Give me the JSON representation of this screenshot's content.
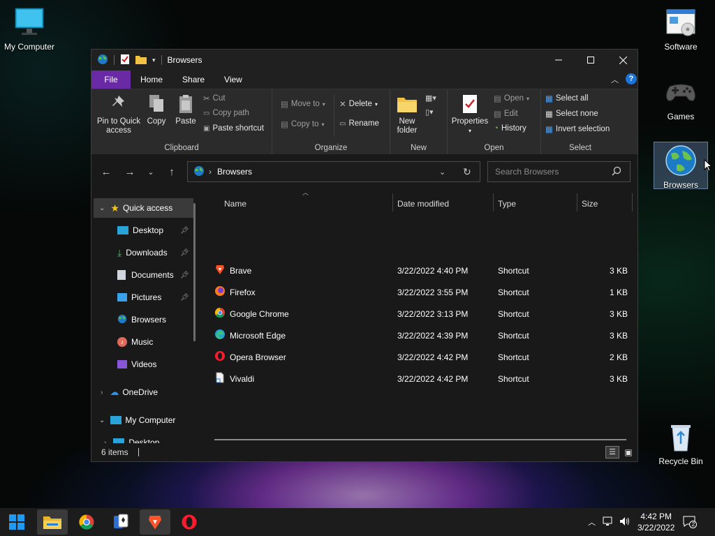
{
  "desktop": {
    "icons": [
      {
        "label": "My Computer"
      },
      {
        "label": "Software"
      },
      {
        "label": "Games"
      },
      {
        "label": "Browsers"
      },
      {
        "label": "Recycle Bin"
      }
    ]
  },
  "window": {
    "title": "Browsers",
    "tabs": [
      "File",
      "Home",
      "Share",
      "View"
    ],
    "ribbon": {
      "clipboard": {
        "group_label": "Clipboard",
        "pin_label": "Pin to Quick access",
        "copy_label": "Copy",
        "paste_label": "Paste",
        "cut_label": "Cut",
        "copy_path_label": "Copy path",
        "paste_shortcut_label": "Paste shortcut"
      },
      "organize": {
        "group_label": "Organize",
        "move_to_label": "Move to",
        "copy_to_label": "Copy to",
        "delete_label": "Delete",
        "rename_label": "Rename"
      },
      "new": {
        "group_label": "New",
        "new_folder_label": "New folder"
      },
      "open": {
        "group_label": "Open",
        "properties_label": "Properties",
        "open_label": "Open",
        "edit_label": "Edit",
        "history_label": "History"
      },
      "select": {
        "group_label": "Select",
        "select_all_label": "Select all",
        "select_none_label": "Select none",
        "invert_selection_label": "Invert selection"
      }
    },
    "address": {
      "path": "Browsers"
    },
    "search": {
      "placeholder": "Search Browsers"
    },
    "navigation": {
      "quick_access": "Quick access",
      "quick_items": [
        "Desktop",
        "Downloads",
        "Documents",
        "Pictures",
        "Browsers",
        "Music",
        "Videos"
      ],
      "onedrive": "OneDrive",
      "my_computer": "My Computer",
      "my_computer_items": [
        "Desktop"
      ]
    },
    "columns": {
      "name": "Name",
      "date": "Date modified",
      "type": "Type",
      "size": "Size"
    },
    "files": [
      {
        "name": "Brave",
        "date": "3/22/2022 4:40 PM",
        "type": "Shortcut",
        "size": "3 KB"
      },
      {
        "name": "Firefox",
        "date": "3/22/2022 3:55 PM",
        "type": "Shortcut",
        "size": "1 KB"
      },
      {
        "name": "Google Chrome",
        "date": "3/22/2022 3:13 PM",
        "type": "Shortcut",
        "size": "3 KB"
      },
      {
        "name": "Microsoft Edge",
        "date": "3/22/2022 4:39 PM",
        "type": "Shortcut",
        "size": "3 KB"
      },
      {
        "name": "Opera Browser",
        "date": "3/22/2022 4:42 PM",
        "type": "Shortcut",
        "size": "2 KB"
      },
      {
        "name": "Vivaldi",
        "date": "3/22/2022 4:42 PM",
        "type": "Shortcut",
        "size": "3 KB"
      }
    ],
    "status": {
      "item_count": "6 items"
    }
  },
  "taskbar": {
    "clock_time": "4:42 PM",
    "clock_date": "3/22/2022",
    "notification_count": "2"
  },
  "colors": {
    "file_tab": "#6b2aa5",
    "window_bg": "#191919",
    "ribbon_bg": "#2b2b2b",
    "help_blue": "#1e73d8"
  }
}
